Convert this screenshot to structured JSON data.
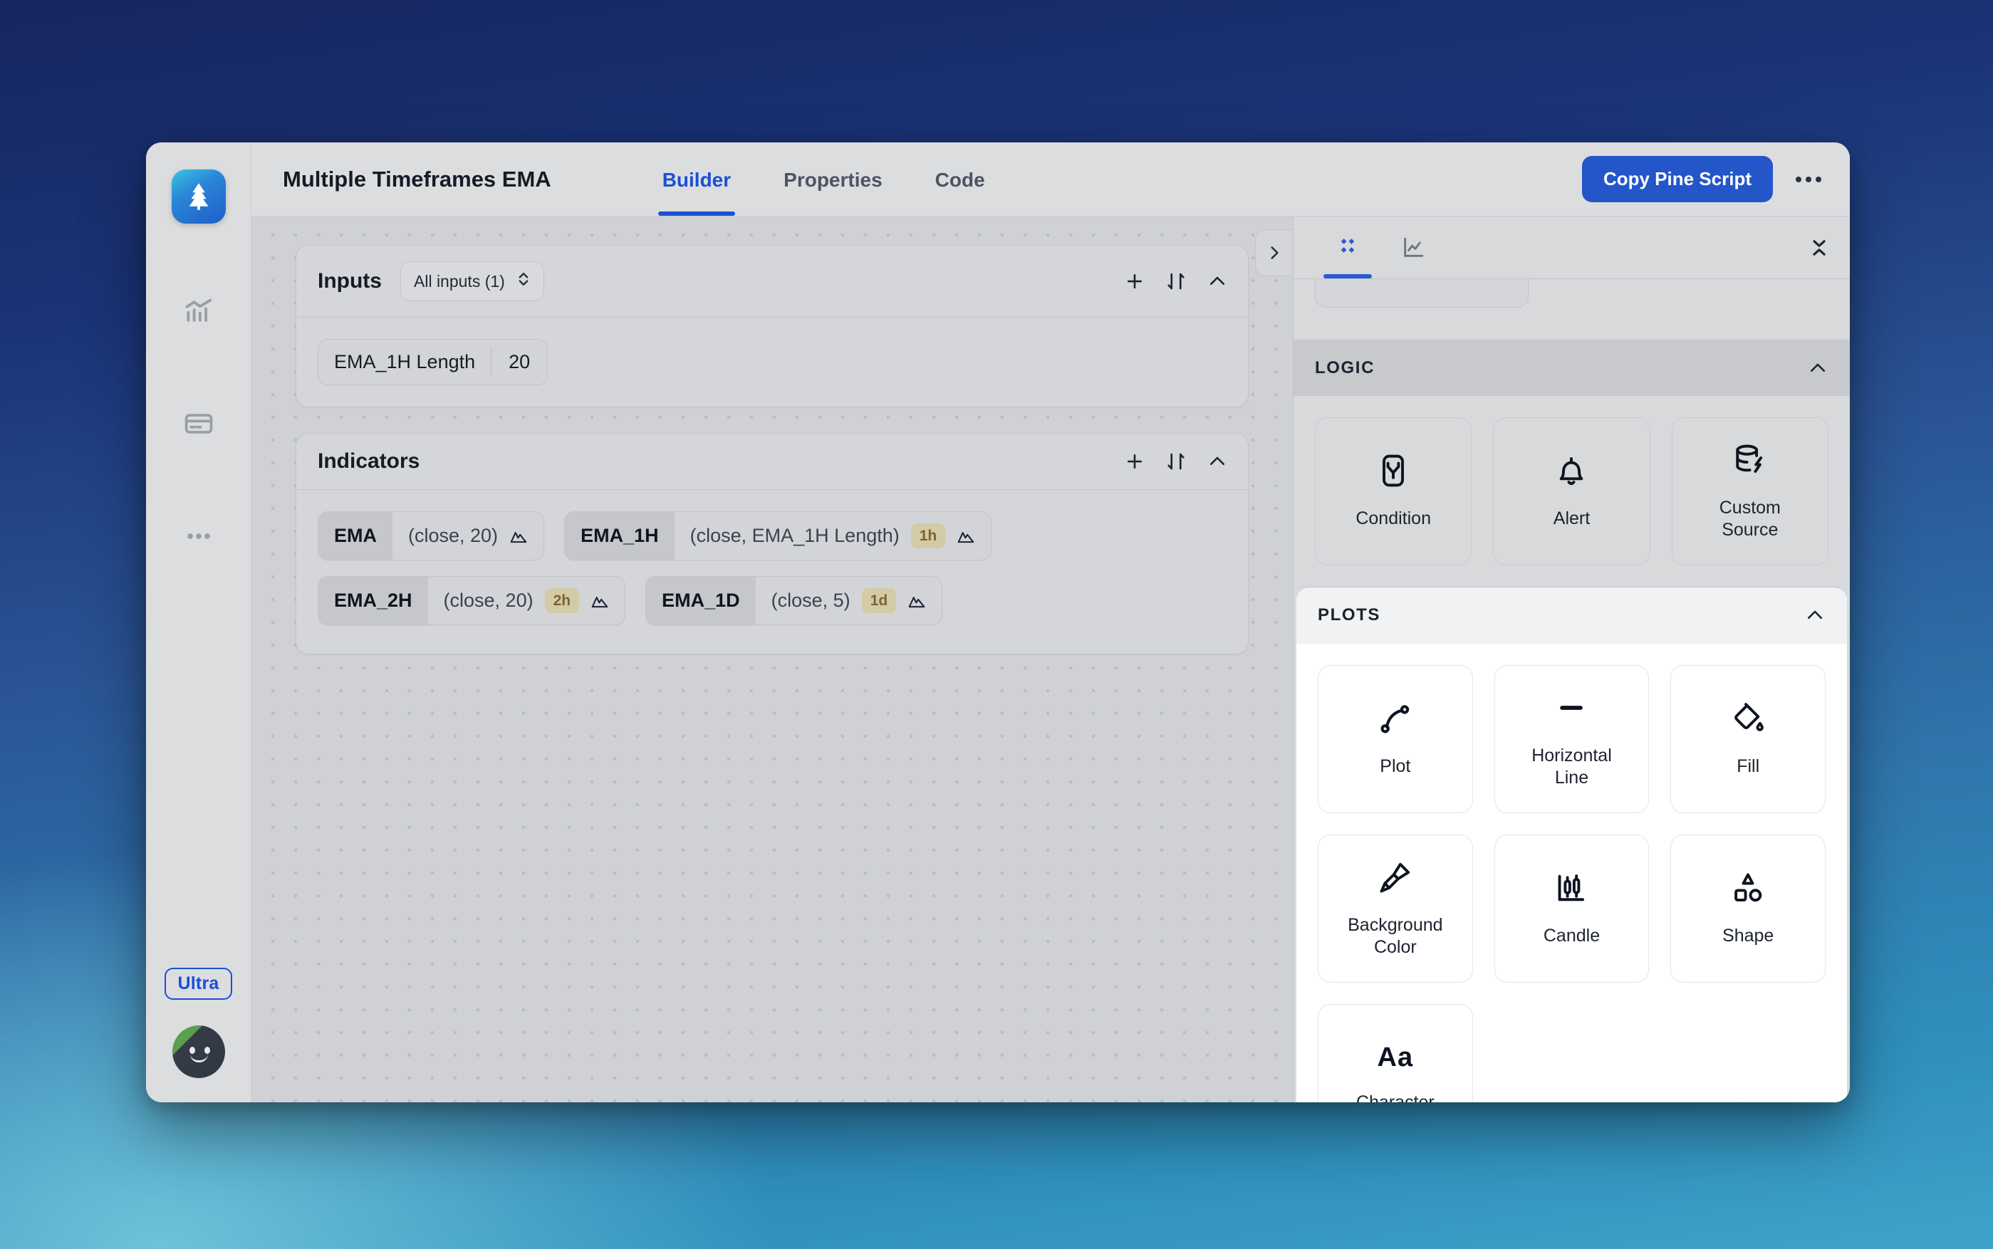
{
  "app": {
    "title": "Multiple Timeframes EMA",
    "logo_icon": "pine-tree-icon"
  },
  "topbar": {
    "tabs": [
      {
        "label": "Builder",
        "active": true
      },
      {
        "label": "Properties",
        "active": false
      },
      {
        "label": "Code",
        "active": false
      }
    ],
    "primary_button": "Copy Pine Script",
    "overflow_icon": "ellipsis-icon",
    "accent_color": "#2456c9"
  },
  "rail": {
    "items": [
      {
        "name": "analytics-icon"
      },
      {
        "name": "billing-card-icon"
      },
      {
        "name": "more-icon"
      }
    ],
    "plan_badge": "Ultra",
    "avatar_icon": "user-avatar"
  },
  "inputs_section": {
    "title": "Inputs",
    "filter_label": "All inputs (1)",
    "filter_chevron_icon": "chevron-updown-icon",
    "actions": [
      {
        "name": "add-icon"
      },
      {
        "name": "sort-icon"
      },
      {
        "name": "collapse-icon"
      }
    ],
    "items": [
      {
        "label": "EMA_1H Length",
        "value": "20"
      }
    ]
  },
  "indicators_section": {
    "title": "Indicators",
    "actions": [
      {
        "name": "add-icon"
      },
      {
        "name": "sort-icon"
      },
      {
        "name": "collapse-icon"
      }
    ],
    "items": [
      {
        "name": "EMA",
        "args": "(close, 20)",
        "timeframe": "",
        "icon": "mountain-icon"
      },
      {
        "name": "EMA_1H",
        "args": "(close, EMA_1H Length)",
        "timeframe": "1h",
        "icon": "mountain-icon"
      },
      {
        "name": "EMA_2H",
        "args": "(close, 20)",
        "timeframe": "2h",
        "icon": "mountain-icon"
      },
      {
        "name": "EMA_1D",
        "args": "(close, 5)",
        "timeframe": "1d",
        "icon": "mountain-icon"
      }
    ],
    "badge_bg": "#d3cba6",
    "badge_fg": "#7d6330"
  },
  "right_panel": {
    "expand_icon": "chevron-right-icon",
    "tabs": [
      {
        "name": "blocks-icon",
        "active": true
      },
      {
        "name": "chart-icon",
        "active": false
      }
    ],
    "collapse_all_icon": "collapse-all-icon",
    "sections": [
      {
        "title": "LOGIC",
        "chevron_icon": "chevron-up-icon",
        "cards": [
          {
            "label": "Condition",
            "icon": "branch-condition-icon"
          },
          {
            "label": "Alert",
            "icon": "bell-icon"
          },
          {
            "label": "Custom\nSource",
            "icon": "database-bolt-icon",
            "line1": "Custom",
            "line2": "Source"
          }
        ]
      },
      {
        "title": "PLOTS",
        "chevron_icon": "chevron-up-icon",
        "cards": [
          {
            "label": "Plot",
            "icon": "curve-plot-icon"
          },
          {
            "label": "Horizontal Line",
            "icon": "horizontal-line-icon",
            "line1": "Horizontal",
            "line2": "Line"
          },
          {
            "label": "Fill",
            "icon": "paint-bucket-icon"
          },
          {
            "label": "Background Color",
            "icon": "paint-brush-icon",
            "line1": "Background",
            "line2": "Color"
          },
          {
            "label": "Candle",
            "icon": "candlestick-icon"
          },
          {
            "label": "Shape",
            "icon": "shapes-icon"
          },
          {
            "label": "Character",
            "icon": "aa-text-icon",
            "glyph": "Aa"
          }
        ]
      }
    ]
  }
}
